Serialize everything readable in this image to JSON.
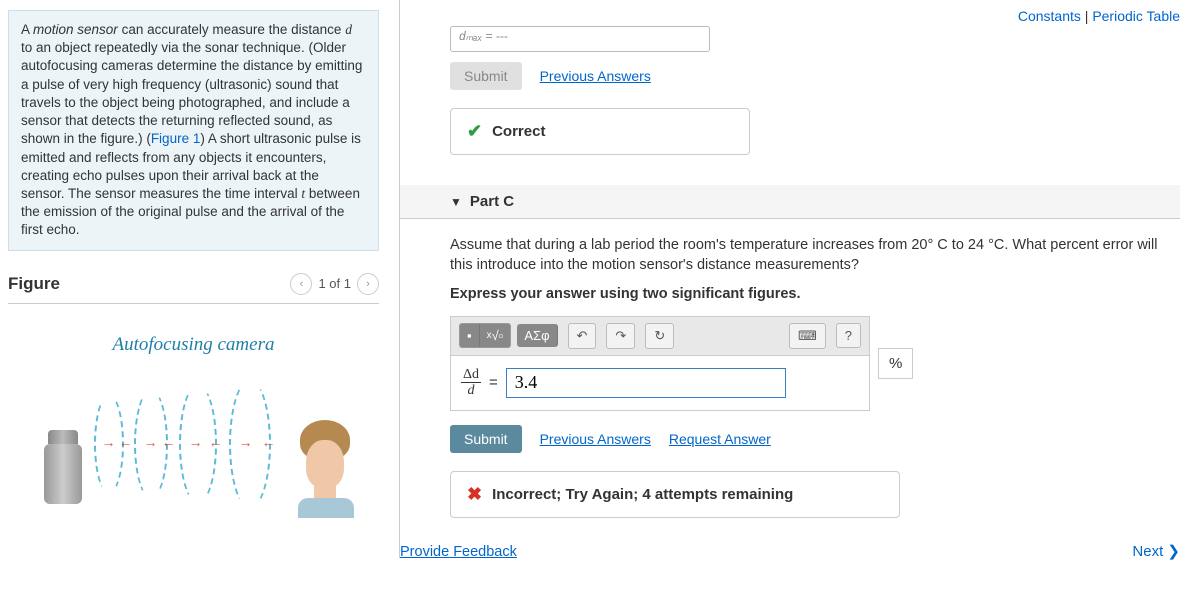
{
  "topLinks": {
    "constants": "Constants",
    "sep": " | ",
    "periodic": "Periodic Table"
  },
  "intro": {
    "prefix": "A ",
    "motionSensor": "motion sensor",
    "text1": " can accurately measure the distance ",
    "var_d": "d",
    "text2": " to an object repeatedly via the sonar technique. (Older autofocusing cameras determine the distance by emitting a pulse of very high frequency (ultrasonic) sound that travels to the object being photographed, and include a sensor that detects the returning reflected sound, as shown in the figure.) (",
    "figLink": "Figure 1",
    "text3": ") A short ultrasonic pulse is emitted and reflects from any objects it encounters, creating echo pulses upon their arrival back at the sensor. The sensor measures the time interval ",
    "var_t": "t",
    "text4": " between the emission of the original pulse and the arrival of the first echo."
  },
  "figure": {
    "heading": "Figure",
    "pager": "1 of 1",
    "caption": "Autofocusing camera"
  },
  "prevInput": "dₘₐₓ = ---",
  "btn": {
    "submitDisabled": "Submit",
    "submit": "Submit",
    "prevAnswers": "Previous Answers",
    "requestAnswer": "Request Answer"
  },
  "correct": "Correct",
  "partC": {
    "title": "Part C",
    "question": "Assume that during a lab period the room's temperature increases from 20° C to 24 °C. What percent error will this introduce into the motion sensor's distance measurements?",
    "express": "Express your answer using two significant figures.",
    "symbolBtn": "ΑΣφ",
    "helpBtn": "?",
    "fracNum": "Δd",
    "fracDen": "d",
    "eq": "=",
    "value": "3.4",
    "unit": "%"
  },
  "incorrect": "Incorrect; Try Again; 4 attempts remaining",
  "provideFeedback": "Provide Feedback",
  "next": "Next ❯"
}
